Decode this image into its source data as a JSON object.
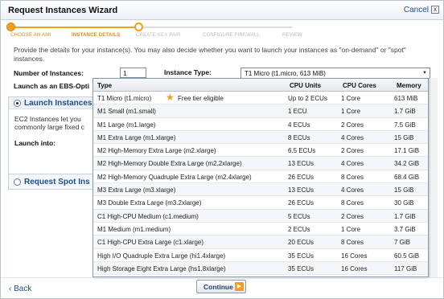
{
  "wizard": {
    "title": "Request Instances Wizard",
    "cancel_label": "Cancel",
    "close_glyph": "x",
    "close_icon": "close-icon"
  },
  "steps": [
    {
      "label": "CHOOSE AN AMI",
      "state": "done"
    },
    {
      "label": "INSTANCE DETAILS",
      "state": "current"
    },
    {
      "label": "CREATE KEY PAIR",
      "state": "todo"
    },
    {
      "label": "CONFIGURE FIREWALL",
      "state": "todo"
    },
    {
      "label": "REVIEW",
      "state": "todo"
    }
  ],
  "intro": "Provide the details for your instance(s). You may also decide whether you want to launch your instances as \"on-demand\" or \"spot\" instances.",
  "form": {
    "num_instances_label": "Number of Instances:",
    "num_instances_value": "1",
    "instance_type_label": "Instance Type:",
    "instance_type_value": "T1 Micro (t1.micro, 613 MiB)",
    "ebs_label": "Launch as an EBS-Opti"
  },
  "launch_panel": {
    "radio_label": "Launch Instances",
    "text": "EC2 Instances let you commonly large fixed c",
    "launch_into_label": "Launch into:"
  },
  "spot_panel": {
    "radio_label": "Request Spot Ins"
  },
  "dropdown": {
    "headers": {
      "type": "Type",
      "cpu": "CPU Units",
      "cores": "CPU Cores",
      "memory": "Memory"
    },
    "free_tier_label": "Free tier eligible",
    "rows": [
      {
        "type": "T1 Micro (t1.micro)",
        "cpu": "Up to 2 ECUs",
        "cores": "1 Core",
        "memory": "613 MiB",
        "free_tier": true
      },
      {
        "type": "M1 Small (m1.small)",
        "cpu": "1 ECU",
        "cores": "1 Core",
        "memory": "1.7 GiB"
      },
      {
        "type": "M1 Large (m1.large)",
        "cpu": "4 ECUs",
        "cores": "2 Cores",
        "memory": "7.5 GiB"
      },
      {
        "type": "M1 Extra Large (m1.xlarge)",
        "cpu": "8 ECUs",
        "cores": "4 Cores",
        "memory": "15 GiB"
      },
      {
        "type": "M2 High-Memory Extra Large (m2.xlarge)",
        "cpu": "6.5 ECUs",
        "cores": "2 Cores",
        "memory": "17.1 GiB"
      },
      {
        "type": "M2 High-Memory Double Extra Large (m2.2xlarge)",
        "cpu": "13 ECUs",
        "cores": "4 Cores",
        "memory": "34.2 GiB"
      },
      {
        "type": "M2 High-Memory Quadruple Extra Large (m2.4xlarge)",
        "cpu": "26 ECUs",
        "cores": "8 Cores",
        "memory": "68.4 GiB"
      },
      {
        "type": "M3 Extra Large (m3.xlarge)",
        "cpu": "13 ECUs",
        "cores": "4 Cores",
        "memory": "15 GiB"
      },
      {
        "type": "M3 Double Extra Large (m3.2xlarge)",
        "cpu": "26 ECUs",
        "cores": "8 Cores",
        "memory": "30 GiB"
      },
      {
        "type": "C1 High-CPU Medium (c1.medium)",
        "cpu": "5 ECUs",
        "cores": "2 Cores",
        "memory": "1.7 GiB"
      },
      {
        "type": "M1 Medium (m1.medium)",
        "cpu": "2 ECUs",
        "cores": "1 Core",
        "memory": "3.7 GiB"
      },
      {
        "type": "C1 High-CPU Extra Large (c1.xlarge)",
        "cpu": "20 ECUs",
        "cores": "8 Cores",
        "memory": "7 GiB"
      },
      {
        "type": "High I/O Quadruple Extra Large (hi1.4xlarge)",
        "cpu": "35 ECUs",
        "cores": "16 Cores",
        "memory": "60.5 GiB"
      },
      {
        "type": "High Storage Eight Extra Large (hs1.8xlarge)",
        "cpu": "35 ECUs",
        "cores": "16 Cores",
        "memory": "117 GiB"
      }
    ]
  },
  "footer": {
    "back_label": "‹ Back",
    "continue_label": "Continue",
    "continue_icon": "arrow-right-icon"
  },
  "colors": {
    "accent": "#f0a020",
    "link": "#1d4f8c"
  }
}
